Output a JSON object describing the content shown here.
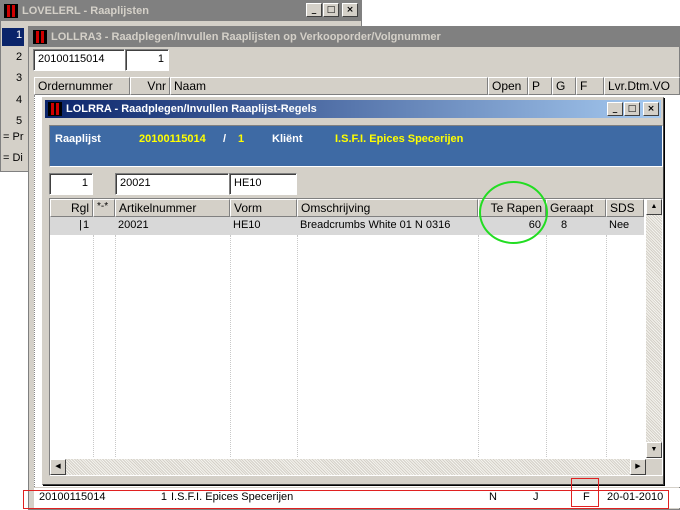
{
  "background_window": {
    "title": "LOVELERL - Raaplijsten",
    "side_rows": [
      "1",
      "2",
      "3",
      "4",
      "5"
    ],
    "side_labels": [
      "= Pr",
      "= Di"
    ]
  },
  "middle_window": {
    "title": "LOLLRA3 - Raadplegen/Invullen Raaplijsten op Verkooporder/Volgnummer",
    "order_field": "20100115014",
    "seq_field": "1",
    "columns": [
      "Ordernummer",
      "Vnr",
      "Naam",
      "Open",
      "P",
      "G",
      "F",
      "Lvr.Dtm.VO"
    ]
  },
  "front_window": {
    "title": "LOLRRA - Raadplegen/Invullen Raaplijst-Regels",
    "info": {
      "raaplijst_label": "Raaplijst",
      "raaplijst_value": "20100115014",
      "separator": "/",
      "seq_value": "1",
      "client_label": "Kliënt",
      "client_value": "I.S.F.I. Epices Specerijen"
    },
    "filters": {
      "regel": "1",
      "artikel": "20021",
      "vorm": "HE10"
    },
    "table": {
      "columns": [
        "Rgl",
        "*-*",
        "Artikelnummer",
        "Vorm",
        "Omschrijving",
        "Te Rapen",
        "Geraapt",
        "SDS"
      ],
      "rows": [
        {
          "marker": "|",
          "rgl": "1",
          "artikel": "20021",
          "vorm": "HE10",
          "omschrijving": "Breadcrumbs White 01 N 0316",
          "te_rapen": "60",
          "geraapt": "8",
          "sds": "Nee"
        }
      ]
    }
  },
  "status_row": {
    "ordernummer": "20100115014",
    "vnr": "1",
    "naam": "I.S.F.I. Epices Specerijen",
    "open": "N",
    "p": "J",
    "f": "F",
    "lvr_dtm": "20-01-2010"
  },
  "window_buttons": {
    "minimize": "_",
    "maximize": "□",
    "close": "×"
  },
  "scrollbar_arrows": {
    "up": "▲",
    "down": "▼",
    "left": "◀",
    "right": "▶"
  },
  "colors": {
    "info_panel_bg": "#3e6aa4",
    "info_highlight": "#ffff00",
    "annotation_green": "#22dd22",
    "annotation_red": "#e02020"
  }
}
